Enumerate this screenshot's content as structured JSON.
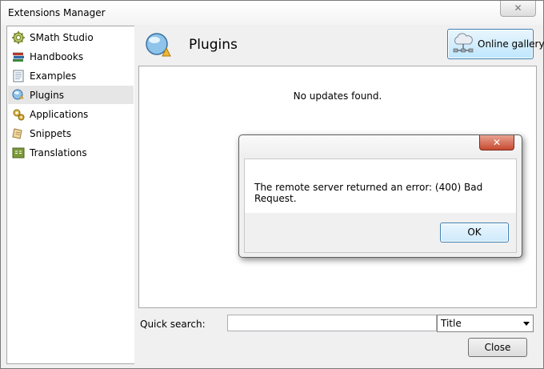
{
  "window": {
    "title": "Extensions Manager",
    "close_glyph": "✕"
  },
  "sidebar": {
    "items": [
      {
        "label": "SMath Studio",
        "icon": "gear-icon",
        "selected": false
      },
      {
        "label": "Handbooks",
        "icon": "books-icon",
        "selected": false
      },
      {
        "label": "Examples",
        "icon": "document-icon",
        "selected": false
      },
      {
        "label": "Plugins",
        "icon": "plugin-icon",
        "selected": true
      },
      {
        "label": "Applications",
        "icon": "gears-icon",
        "selected": false
      },
      {
        "label": "Snippets",
        "icon": "snippet-icon",
        "selected": false
      },
      {
        "label": "Translations",
        "icon": "translation-icon",
        "selected": false
      }
    ]
  },
  "main": {
    "title": "Plugins",
    "gallery_button": "Online gallery",
    "status": "No updates found.",
    "quick_search": {
      "label": "Quick search:",
      "value": "",
      "placeholder": ""
    },
    "filter": {
      "selected": "Title"
    },
    "close_button": "Close"
  },
  "dialog": {
    "message": "The remote server returned an error: (400) Bad Request.",
    "ok_button": "OK",
    "close_glyph": "✕"
  },
  "colors": {
    "selected_bg": "#e6e6e6",
    "accent_border": "#3c7fb1",
    "dialog_close": "#c74a30"
  }
}
